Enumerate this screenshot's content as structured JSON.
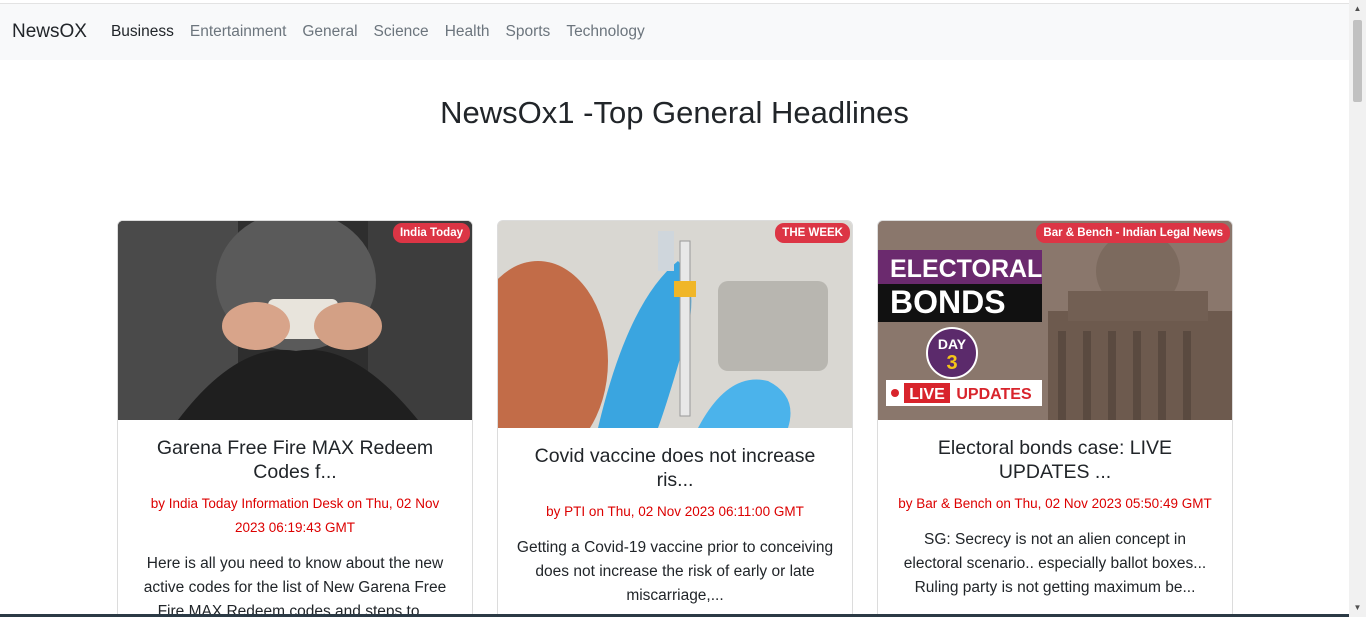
{
  "navbar": {
    "brand": "NewsOX",
    "links": [
      "Business",
      "Entertainment",
      "General",
      "Science",
      "Health",
      "Sports",
      "Technology"
    ]
  },
  "page": {
    "title": "NewsOx1 -Top General Headlines"
  },
  "cards": [
    {
      "source": "India Today",
      "title": "Garena Free Fire MAX Redeem Codes f...",
      "meta": "by India Today Information Desk on Thu, 02 Nov 2023 06:19:43 GMT",
      "description": "Here is all you need to know about the new active codes for the list of New Garena Free Fire MAX Redeem codes and steps to..."
    },
    {
      "source": "THE WEEK",
      "title": "Covid vaccine does not increase ris...",
      "meta": "by PTI on Thu, 02 Nov 2023 06:11:00 GMT",
      "description": "Getting a Covid-19 vaccine prior to conceiving does not increase the risk of early or late miscarriage,..."
    },
    {
      "source": "Bar & Bench - Indian Legal News",
      "title": "Electoral bonds case: LIVE UPDATES ...",
      "meta": "by Bar & Bench on Thu, 02 Nov 2023 05:50:49 GMT",
      "description": "SG: Secrecy is not an alien concept in electoral scenario.. especially ballot boxes... Ruling party is not getting maximum be..."
    }
  ],
  "image_text": {
    "electoral": "ELECTORAL",
    "bonds": "BONDS",
    "day": "DAY",
    "day_num": "3",
    "live": "LIVE",
    "updates": "UPDATES"
  },
  "colors": {
    "badge": "#dc3545",
    "meta": "#dc0000",
    "navbar_bg": "#f8f9fa"
  }
}
